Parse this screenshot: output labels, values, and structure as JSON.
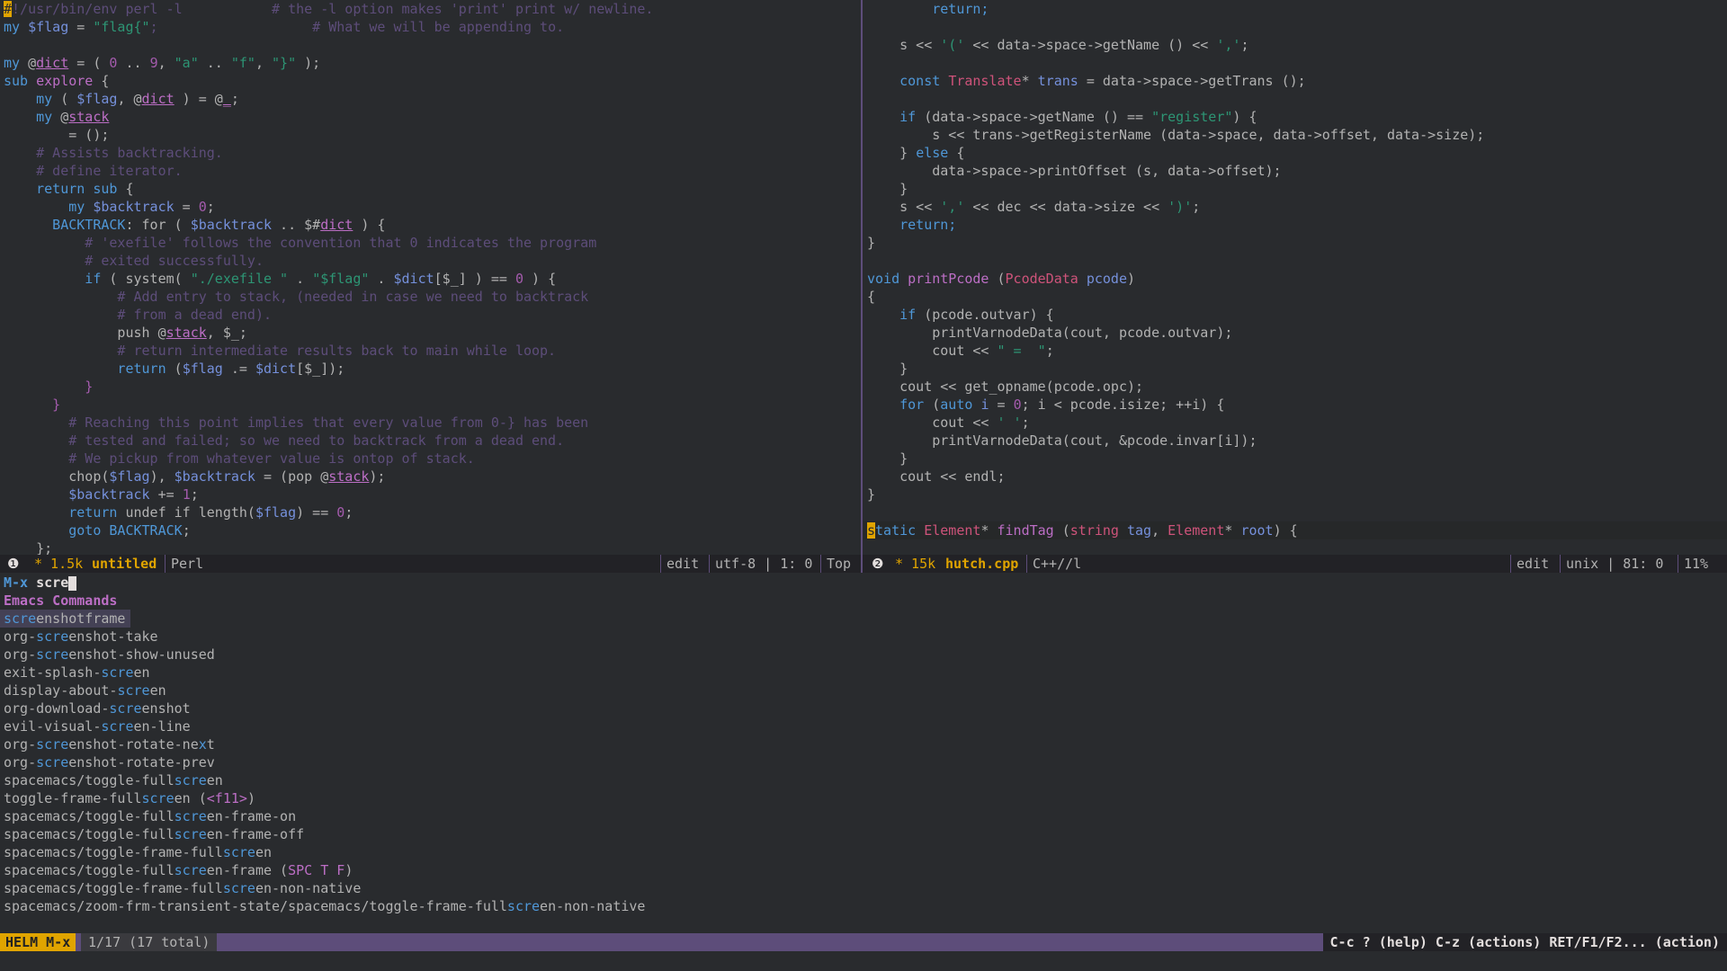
{
  "colors": {
    "bg": "#292b2e",
    "accent": "#5d4d7a",
    "helm": "#e0a400",
    "match": "#4f97d7"
  },
  "left": {
    "lines": [
      [
        [
          "#",
          "cur"
        ],
        [
          "!/usr/bin/env perl -l           # the -l option makes 'print' print w/ newline.",
          "com"
        ]
      ],
      [
        [
          "my ",
          "kw"
        ],
        [
          "$flag",
          "var"
        ],
        [
          " = ",
          "txt"
        ],
        [
          "\"flag{\"",
          "str"
        ],
        [
          ";                   # What we will be appending to.",
          "com"
        ]
      ],
      [],
      [
        [
          "my ",
          "kw"
        ],
        [
          "@",
          "txt"
        ],
        [
          "dict",
          "und"
        ],
        [
          " = ( ",
          "txt"
        ],
        [
          "0",
          "num"
        ],
        [
          " .. ",
          "txt"
        ],
        [
          "9",
          "num"
        ],
        [
          ", ",
          "txt"
        ],
        [
          "\"a\"",
          "str"
        ],
        [
          " .. ",
          "txt"
        ],
        [
          "\"f\"",
          "str"
        ],
        [
          ", ",
          "txt"
        ],
        [
          "\"}\"",
          "str"
        ],
        [
          " );",
          "txt"
        ]
      ],
      [
        [
          "sub ",
          "kw"
        ],
        [
          "explore",
          "fn"
        ],
        [
          " {",
          "txt"
        ]
      ],
      [
        [
          "    my ",
          "kw"
        ],
        [
          "( ",
          "txt"
        ],
        [
          "$flag",
          "var"
        ],
        [
          ", @",
          "txt"
        ],
        [
          "dict",
          "und"
        ],
        [
          " ) = @",
          "txt"
        ],
        [
          "_",
          "und"
        ],
        [
          ";",
          "txt"
        ]
      ],
      [
        [
          "    my ",
          "kw"
        ],
        [
          "@",
          "txt"
        ],
        [
          "stack",
          "und"
        ]
      ],
      [
        [
          "        = ();",
          "txt"
        ]
      ],
      [
        [
          "    # Assists backtracking.",
          "com"
        ]
      ],
      [
        [
          "    # define iterator.",
          "com"
        ]
      ],
      [
        [
          "    return sub ",
          "kw"
        ],
        [
          "{",
          "txt"
        ]
      ],
      [
        [
          "        my ",
          "kw"
        ],
        [
          "$backtrack",
          "var"
        ],
        [
          " = ",
          "txt"
        ],
        [
          "0",
          "num"
        ],
        [
          ";",
          "txt"
        ]
      ],
      [
        [
          "      BACKTRACK",
          "kw"
        ],
        [
          ": for ( ",
          "txt"
        ],
        [
          "$backtrack",
          "var"
        ],
        [
          " .. $#",
          "txt"
        ],
        [
          "dict",
          "und"
        ],
        [
          " ) {",
          "txt"
        ]
      ],
      [
        [
          "          # 'exefile' follows the convention that 0 indicates the program",
          "com"
        ]
      ],
      [
        [
          "          # exited successfully.",
          "com"
        ]
      ],
      [
        [
          "          if ",
          "kw"
        ],
        [
          "( system( ",
          "txt"
        ],
        [
          "\"./exefile \"",
          "str"
        ],
        [
          " . ",
          "txt"
        ],
        [
          "\"$flag\"",
          "str"
        ],
        [
          " . ",
          "txt"
        ],
        [
          "$dict",
          "var"
        ],
        [
          "[$_] ) == ",
          "txt"
        ],
        [
          "0",
          "num"
        ],
        [
          " ) {",
          "txt"
        ]
      ],
      [
        [
          "              # Add entry to stack, (needed in case we need to backtrack",
          "com"
        ]
      ],
      [
        [
          "              # from a dead end).",
          "com"
        ]
      ],
      [
        [
          "              push ",
          "txt"
        ],
        [
          "@",
          "txt"
        ],
        [
          "stack",
          "und"
        ],
        [
          ", $_;",
          "txt"
        ]
      ],
      [
        [
          "              # return intermediate results back to main while loop.",
          "com"
        ]
      ],
      [
        [
          "              return ",
          "kw"
        ],
        [
          "(",
          "txt"
        ],
        [
          "$flag",
          "var"
        ],
        [
          " .= ",
          "txt"
        ],
        [
          "$dict",
          "var"
        ],
        [
          "[$_]);",
          "txt"
        ]
      ],
      [
        [
          "          }",
          "par"
        ]
      ],
      [
        [
          "      }",
          "par"
        ]
      ],
      [
        [
          "        # Reaching this point implies that every value from 0-} has been",
          "com"
        ]
      ],
      [
        [
          "        # tested and failed; so we need to backtrack from a dead end.",
          "com"
        ]
      ],
      [
        [
          "        # We pickup from whatever value is ontop of stack.",
          "com"
        ]
      ],
      [
        [
          "        chop(",
          "txt"
        ],
        [
          "$flag",
          "var"
        ],
        [
          "), ",
          "txt"
        ],
        [
          "$backtrack",
          "var"
        ],
        [
          " = (pop @",
          "txt"
        ],
        [
          "stack",
          "und"
        ],
        [
          ");",
          "txt"
        ]
      ],
      [
        [
          "        $backtrack",
          "var"
        ],
        [
          " += ",
          "txt"
        ],
        [
          "1",
          "num"
        ],
        [
          ";",
          "txt"
        ]
      ],
      [
        [
          "        return ",
          "kw"
        ],
        [
          "undef if length(",
          "txt"
        ],
        [
          "$flag",
          "var"
        ],
        [
          ") == ",
          "txt"
        ],
        [
          "0",
          "num"
        ],
        [
          ";",
          "txt"
        ]
      ],
      [
        [
          "        goto ",
          "kw"
        ],
        [
          "BACKTRACK",
          "kw"
        ],
        [
          ";",
          "txt"
        ]
      ],
      [
        [
          "    };",
          "txt"
        ]
      ]
    ],
    "modeline": {
      "num": "❶",
      "buffer_size": "* 1.5k",
      "buffer_name": "untitled",
      "mode": "Perl",
      "state": "edit",
      "encoding": "utf-8 | 1: 0",
      "position": "Top"
    }
  },
  "right": {
    "lines": [
      [
        [
          "        return;",
          "kw"
        ]
      ],
      [],
      [
        [
          "    s << ",
          "txt"
        ],
        [
          "'('",
          "str"
        ],
        [
          " << data->space->getName () << ",
          "txt"
        ],
        [
          "','",
          "str"
        ],
        [
          ";",
          "txt"
        ]
      ],
      [],
      [
        [
          "    const ",
          "kw"
        ],
        [
          "Translate",
          "type"
        ],
        [
          "* ",
          "txt"
        ],
        [
          "trans",
          "var"
        ],
        [
          " = data->space->getTrans ();",
          "txt"
        ]
      ],
      [],
      [
        [
          "    if ",
          "kw"
        ],
        [
          "(data->space->getName () == ",
          "txt"
        ],
        [
          "\"register\"",
          "str"
        ],
        [
          ") {",
          "txt"
        ]
      ],
      [
        [
          "        s << trans->getRegisterName (data->space, data->offset, data->size);",
          "txt"
        ]
      ],
      [
        [
          "    } ",
          "txt"
        ],
        [
          "else ",
          "kw"
        ],
        [
          "{",
          "txt"
        ]
      ],
      [
        [
          "        data->space->printOffset (s, data->offset);",
          "txt"
        ]
      ],
      [
        [
          "    }",
          "txt"
        ]
      ],
      [
        [
          "    s << ",
          "txt"
        ],
        [
          "','",
          "str"
        ],
        [
          " << dec << data->size << ",
          "txt"
        ],
        [
          "')'",
          "str"
        ],
        [
          ";",
          "txt"
        ]
      ],
      [
        [
          "    return;",
          "kw"
        ]
      ],
      [
        [
          "}",
          "txt"
        ]
      ],
      [],
      [
        [
          "void ",
          "kw"
        ],
        [
          "printPcode ",
          "fn"
        ],
        [
          "(",
          "txt"
        ],
        [
          "PcodeData ",
          "type"
        ],
        [
          "pcode",
          "var"
        ],
        [
          ")",
          "txt"
        ]
      ],
      [
        [
          "{",
          "txt"
        ]
      ],
      [
        [
          "    if ",
          "kw"
        ],
        [
          "(pcode.outvar) {",
          "txt"
        ]
      ],
      [
        [
          "        printVarnodeData(cout, pcode.outvar);",
          "txt"
        ]
      ],
      [
        [
          "        cout << ",
          "txt"
        ],
        [
          "\" =  \"",
          "str"
        ],
        [
          ";",
          "txt"
        ]
      ],
      [
        [
          "    }",
          "txt"
        ]
      ],
      [
        [
          "    cout << get_opname(pcode.opc);",
          "txt"
        ]
      ],
      [
        [
          "    for ",
          "kw"
        ],
        [
          "(",
          "txt"
        ],
        [
          "auto ",
          "kw"
        ],
        [
          "i",
          "var"
        ],
        [
          " = ",
          "txt"
        ],
        [
          "0",
          "num"
        ],
        [
          "; i < pcode.isize; ++i) {",
          "txt"
        ]
      ],
      [
        [
          "        cout << ",
          "txt"
        ],
        [
          "' '",
          "str"
        ],
        [
          ";",
          "txt"
        ]
      ],
      [
        [
          "        printVarnodeData(cout, &pcode.invar[i]);",
          "txt"
        ]
      ],
      [
        [
          "    }",
          "txt"
        ]
      ],
      [
        [
          "    cout << endl;",
          "txt"
        ]
      ],
      [
        [
          "}",
          "txt"
        ]
      ],
      [],
      [
        [
          "s",
          "cur"
        ],
        [
          "tatic ",
          "kw"
        ],
        [
          "Element",
          "type"
        ],
        [
          "* ",
          "txt"
        ],
        [
          "findTag ",
          "fn"
        ],
        [
          "(",
          "txt"
        ],
        [
          "string ",
          "type"
        ],
        [
          "tag",
          "var"
        ],
        [
          ", ",
          "txt"
        ],
        [
          "Element",
          "type"
        ],
        [
          "* ",
          "txt"
        ],
        [
          "root",
          "var"
        ],
        [
          ") {",
          "txt"
        ]
      ]
    ],
    "modeline": {
      "num": "❷",
      "buffer_size": "* 15k",
      "buffer_name": "hutch.cpp",
      "mode": "C++//l",
      "state": "edit",
      "encoding": "unix | 81: 0",
      "position": "11%"
    }
  },
  "minibuffer": {
    "prompt": "M-x",
    "input": "scre"
  },
  "helm": {
    "header": "Emacs Commands",
    "items": [
      [
        [
          "scre",
          "m"
        ],
        [
          "enshotframe",
          ""
        ]
      ],
      [
        [
          "org-",
          ""
        ],
        [
          "scre",
          "m"
        ],
        [
          "enshot-take",
          ""
        ]
      ],
      [
        [
          "org-",
          ""
        ],
        [
          "scre",
          "m"
        ],
        [
          "enshot-show-unused",
          ""
        ]
      ],
      [
        [
          "exit-splash-",
          ""
        ],
        [
          "scre",
          "m"
        ],
        [
          "en",
          ""
        ]
      ],
      [
        [
          "display-about-",
          ""
        ],
        [
          "scre",
          "m"
        ],
        [
          "en",
          ""
        ]
      ],
      [
        [
          "org-download-",
          ""
        ],
        [
          "scre",
          "m"
        ],
        [
          "enshot",
          ""
        ]
      ],
      [
        [
          "evil-visual-",
          ""
        ],
        [
          "scre",
          "m"
        ],
        [
          "en-line",
          ""
        ]
      ],
      [
        [
          "org-",
          ""
        ],
        [
          "scre",
          "m"
        ],
        [
          "enshot-rotate-ne",
          ""
        ],
        [
          "x",
          "m"
        ],
        [
          "t",
          ""
        ]
      ],
      [
        [
          "org-",
          ""
        ],
        [
          "scre",
          "m"
        ],
        [
          "enshot-rotate-prev",
          ""
        ]
      ],
      [
        [
          "spacemacs/toggle-full",
          ""
        ],
        [
          "scre",
          "m"
        ],
        [
          "en",
          ""
        ]
      ],
      [
        [
          "toggle-frame-full",
          ""
        ],
        [
          "scre",
          "m"
        ],
        [
          "en (",
          ""
        ],
        [
          "<f11>",
          "k"
        ],
        [
          ")",
          ""
        ]
      ],
      [
        [
          "spacemacs/toggle-full",
          ""
        ],
        [
          "scre",
          "m"
        ],
        [
          "en-frame-on",
          ""
        ]
      ],
      [
        [
          "spacemacs/toggle-full",
          ""
        ],
        [
          "scre",
          "m"
        ],
        [
          "en-frame-off",
          ""
        ]
      ],
      [
        [
          "spacemacs/toggle-frame-full",
          ""
        ],
        [
          "scre",
          "m"
        ],
        [
          "en",
          ""
        ]
      ],
      [
        [
          "spacemacs/toggle-full",
          ""
        ],
        [
          "scre",
          "m"
        ],
        [
          "en-frame (",
          ""
        ],
        [
          "SPC T F",
          "k"
        ],
        [
          ")",
          ""
        ]
      ],
      [
        [
          "spacemacs/toggle-frame-full",
          ""
        ],
        [
          "scre",
          "m"
        ],
        [
          "en-non-native",
          ""
        ]
      ],
      [
        [
          "spacemacs/zoom-frm-transient-state/spacemacs/toggle-frame-full",
          ""
        ],
        [
          "scre",
          "m"
        ],
        [
          "en-non-native",
          ""
        ]
      ]
    ],
    "modeline": {
      "tag": "HELM M-x",
      "count": "1/17 (17 total)",
      "keys": "C-c ? (help) C-z (actions) RET/F1/F2... (action)"
    }
  }
}
